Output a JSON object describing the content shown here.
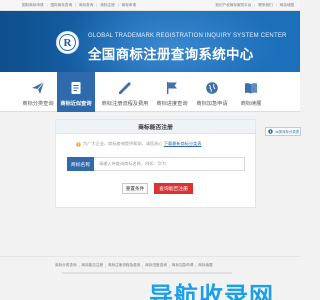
{
  "topbar": {
    "left_links": [
      "国际商标申请",
      "国际商标查询",
      "商标查询",
      "商标注册",
      "商标申请"
    ],
    "right_links": [
      "知识产权商标服务平台",
      "联系我们",
      "网站地图"
    ]
  },
  "banner": {
    "logo_letter": "R",
    "title_en": "GLOBAL TRADEMARK REGISTRATION INQUIRY SYSTEM CENTER",
    "title_cn": "全国商标注册查询系统中心"
  },
  "nav": {
    "items": [
      {
        "label": "商标分类查询",
        "icon": "paper-plane-icon",
        "active": false
      },
      {
        "label": "商标近似查询",
        "icon": "document-icon",
        "active": true
      },
      {
        "label": "商标注册流程及费用",
        "icon": "brush-icon",
        "active": false
      },
      {
        "label": "商标进度查询",
        "icon": "flag-icon",
        "active": false
      },
      {
        "label": "商标加急申请",
        "icon": "globe-icon",
        "active": false
      },
      {
        "label": "商标续展",
        "icon": "book-icon",
        "active": false
      }
    ]
  },
  "side_float": {
    "label": "46类商标分类表"
  },
  "panel": {
    "title": "商标能否注册",
    "notice_prefix": "为广大企业，商标查询提供帮助，请您放心",
    "notice_link": "下载最新商标分类表",
    "search_label": "商标名称",
    "search_placeholder": "请输入待查询商标名称，例如：华为",
    "reset_label": "重置条件",
    "submit_label": "查询能否注册"
  },
  "footer": {
    "links": [
      "商标分类查询",
      "商标能否注册",
      "商标注册流程及费用",
      "商标进度查询",
      "商标加急申请",
      "商标续展"
    ]
  },
  "watermark": "导航收录网",
  "colors": {
    "brand_blue": "#2f6bac",
    "banner_blue": "#1a6ab4",
    "accent_red": "#d93434"
  }
}
